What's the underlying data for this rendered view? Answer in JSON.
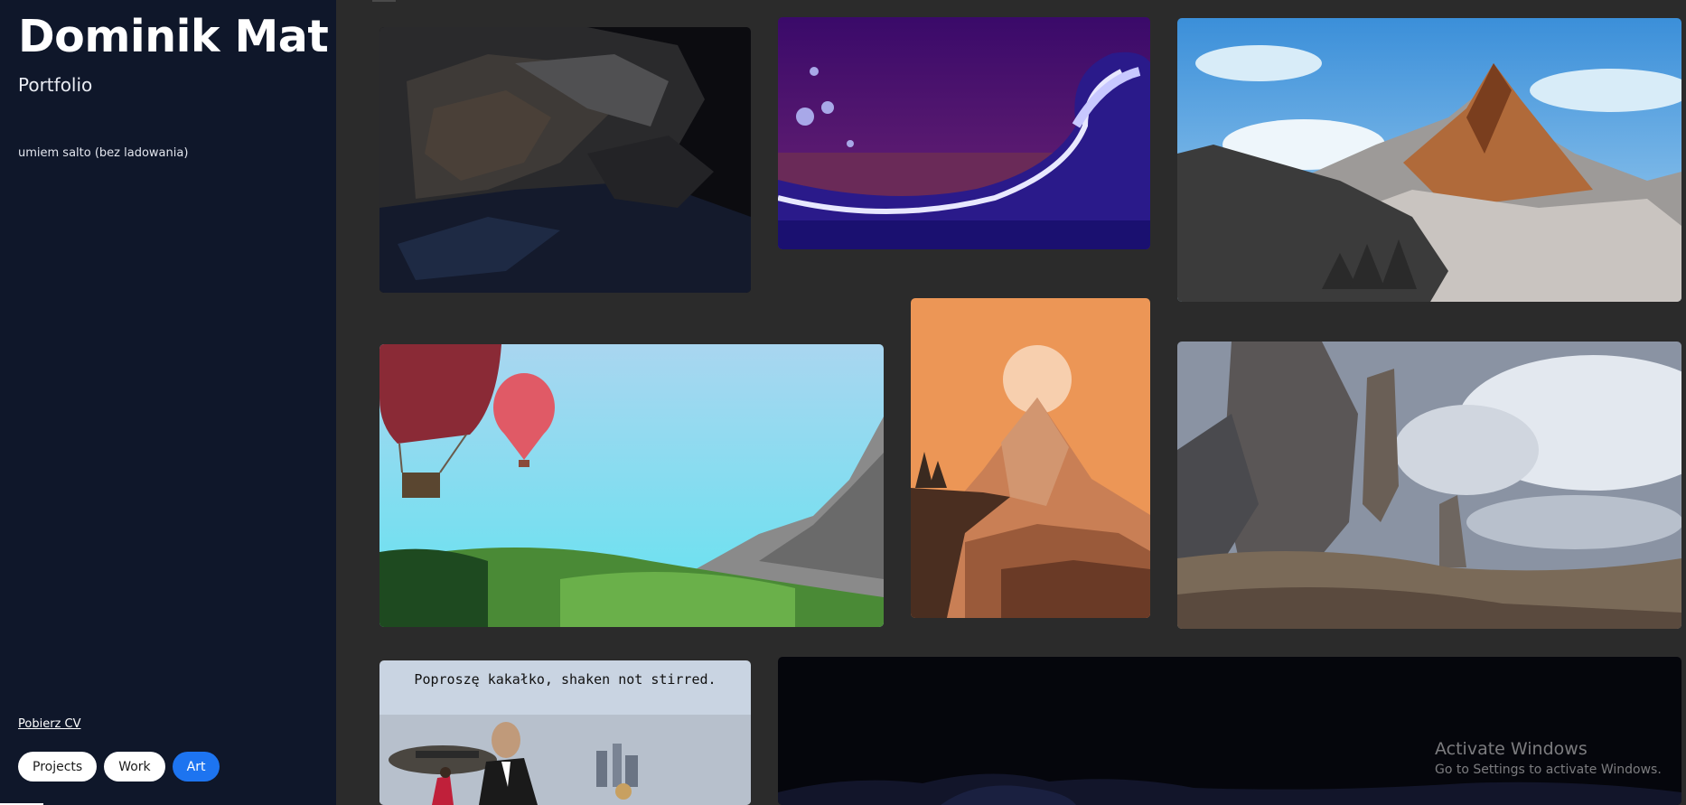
{
  "sidebar": {
    "name": "Dominik Mat",
    "subtitle": "Portfolio",
    "description": "umiem salto (bez ladowania)",
    "cv_link": "Pobierz CV",
    "filters": [
      {
        "label": "Projects",
        "active": false
      },
      {
        "label": "Work",
        "active": false
      },
      {
        "label": "Art",
        "active": true
      }
    ]
  },
  "gallery": {
    "items": [
      {
        "subject": "dark rocky seascape painting"
      },
      {
        "subject": "pixel art great wave on purple sky"
      },
      {
        "subject": "orange mountain peak above clouds"
      },
      {
        "subject": "hot air balloons over green valley"
      },
      {
        "subject": "orange sunset mountain with cliff"
      },
      {
        "subject": "rock towers among clouds"
      },
      {
        "subject": "poster with man in tuxedo",
        "caption": "Poproszę kakałko, shaken not stirred."
      },
      {
        "subject": "dark night painting"
      }
    ]
  },
  "system": {
    "watermark_title": "Activate Windows",
    "watermark_subtitle": "Go to Settings to activate Windows."
  },
  "colors": {
    "sidebar_bg": "#0f172a",
    "page_bg": "#2b2b2b",
    "active_filter": "#1d74f0"
  }
}
